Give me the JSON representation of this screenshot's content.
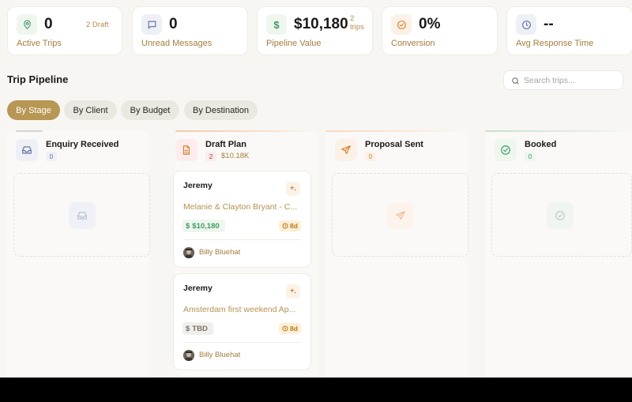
{
  "stats": [
    {
      "value": "0",
      "label": "Active Trips",
      "extra": "2 Draft",
      "icon": "map-pin-icon"
    },
    {
      "value": "0",
      "label": "Unread Messages",
      "icon": "message-square-icon"
    },
    {
      "value": "$10,180",
      "label": "Pipeline Value",
      "extra_top": "2",
      "extra_bottom": "trips",
      "icon": "dollar-icon"
    },
    {
      "value": "0%",
      "label": "Conversion",
      "icon": "target-icon"
    },
    {
      "value": "--",
      "label": "Avg Response Time",
      "icon": "clock-icon"
    }
  ],
  "section_title": "Trip Pipeline",
  "search": {
    "placeholder": "Search trips..."
  },
  "tabs": [
    {
      "label": "By Stage",
      "active": true
    },
    {
      "label": "By Client",
      "active": false
    },
    {
      "label": "By Budget",
      "active": false
    },
    {
      "label": "By Destination",
      "active": false
    }
  ],
  "columns": [
    {
      "name": "Enquiry Received",
      "count": "0",
      "icon": "inbox-icon",
      "empty": true
    },
    {
      "name": "Draft Plan",
      "count": "2",
      "total": "$10.18K",
      "icon": "file-text-icon",
      "cards": [
        {
          "client": "Jeremy",
          "trip": "Melanie & Clayton Bryant - C...",
          "budget": "$10,180",
          "days": "8d",
          "agent": "Billy Bluehat"
        },
        {
          "client": "Jeremy",
          "trip": "Amsterdam first weekend Ap...",
          "budget": "TBD",
          "days": "8d",
          "agent": "Billy Bluehat"
        }
      ]
    },
    {
      "name": "Proposal Sent",
      "count": "0",
      "icon": "send-icon",
      "empty": true
    },
    {
      "name": "Booked",
      "count": "0",
      "icon": "check-circle-icon",
      "empty": true
    }
  ],
  "colors": {
    "accent": "#b89654",
    "green": "#3f9b64",
    "orange": "#d9822b",
    "blue": "#5b6f9a"
  }
}
